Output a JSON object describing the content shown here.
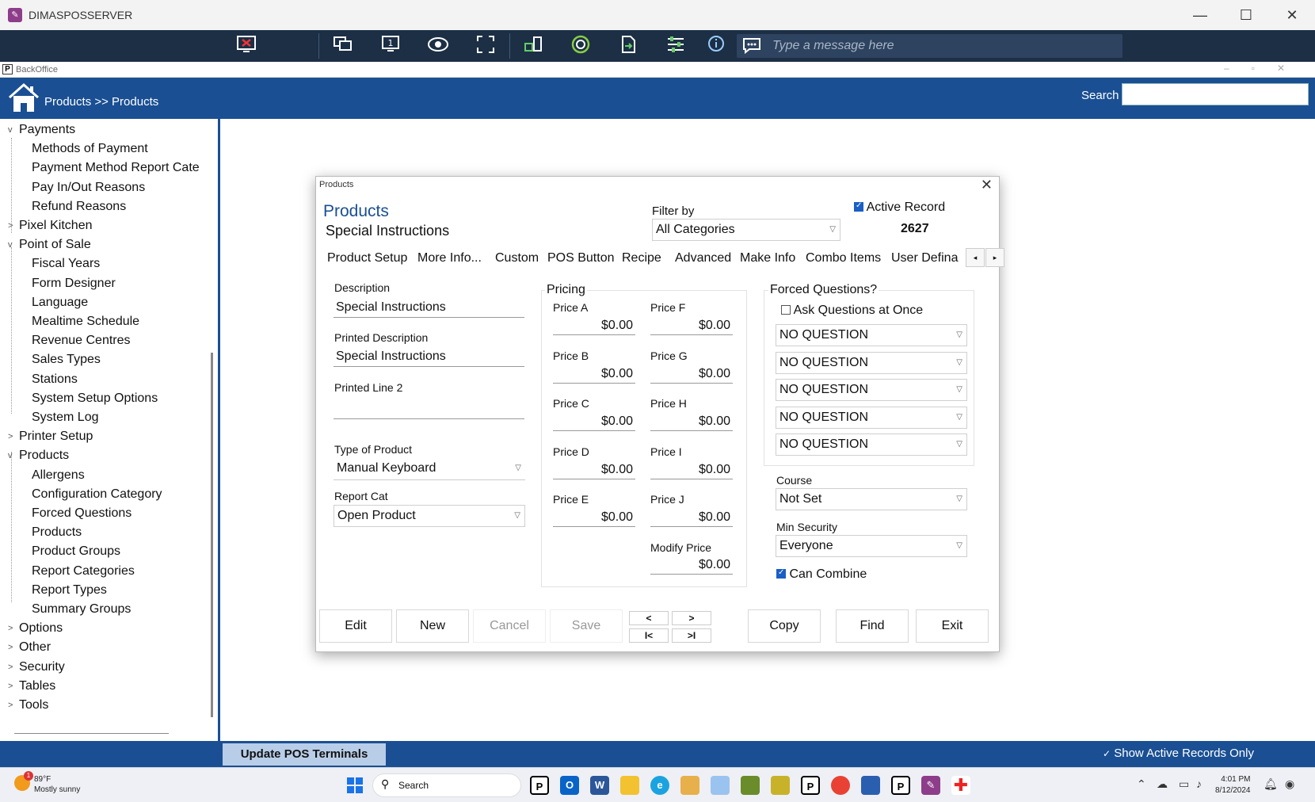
{
  "window": {
    "title": "DIMASPOSSERVER"
  },
  "remote_toolbar": {
    "message_placeholder": "Type a message here",
    "icons": [
      "disconnect-icon",
      "monitor-switch-icon",
      "monitor-1-icon",
      "eye-icon",
      "fullscreen-icon",
      "apps-icon",
      "record-icon",
      "file-transfer-icon",
      "settings-sliders-icon",
      "info-icon",
      "chat-icon"
    ]
  },
  "backoffice": {
    "title": "BackOffice"
  },
  "header": {
    "breadcrumb": "Products >> Products",
    "search_label": "Search",
    "search_value": ""
  },
  "sidebar": {
    "items": [
      {
        "label": "Payments",
        "toggle": "v"
      },
      {
        "label": "Methods of Payment"
      },
      {
        "label": "Payment Method Report Cate"
      },
      {
        "label": "Pay In/Out Reasons"
      },
      {
        "label": "Refund Reasons"
      },
      {
        "label": "Pixel Kitchen",
        "toggle": ">"
      },
      {
        "label": "Point of Sale",
        "toggle": "v"
      },
      {
        "label": "Fiscal Years"
      },
      {
        "label": "Form Designer"
      },
      {
        "label": "Language"
      },
      {
        "label": "Mealtime Schedule"
      },
      {
        "label": "Revenue Centres"
      },
      {
        "label": "Sales Types"
      },
      {
        "label": "Stations"
      },
      {
        "label": "System Setup Options"
      },
      {
        "label": "System Log"
      },
      {
        "label": "Printer Setup",
        "toggle": ">"
      },
      {
        "label": "Products",
        "toggle": "v"
      },
      {
        "label": "Allergens"
      },
      {
        "label": "Configuration Category"
      },
      {
        "label": "Forced Questions"
      },
      {
        "label": "Products"
      },
      {
        "label": "Product Groups"
      },
      {
        "label": "Report Categories"
      },
      {
        "label": "Report Types"
      },
      {
        "label": "Summary Groups"
      },
      {
        "label": "Options",
        "toggle": ">"
      },
      {
        "label": "Other",
        "toggle": ">"
      },
      {
        "label": "Security",
        "toggle": ">"
      },
      {
        "label": "Tables",
        "toggle": ">"
      },
      {
        "label": "Tools",
        "toggle": ">"
      }
    ]
  },
  "dialog": {
    "window_title": "Products",
    "close": "✕",
    "title": "Products",
    "subtitle": "Special Instructions",
    "filter_label": "Filter by",
    "filter_value": "All Categories",
    "active_record_label": "Active Record",
    "record_number": "2627",
    "tabs": [
      "Product Setup",
      "More Info...",
      "Custom",
      "POS Button",
      "Recipe",
      "Advanced",
      "Make Info",
      "Combo Items",
      "User Defina"
    ],
    "tab_prev": "◂",
    "tab_next": "▸",
    "description_label": "Description",
    "description_value": "Special Instructions",
    "printed_description_label": "Printed Description",
    "printed_description_value": "Special Instructions",
    "printed_line2_label": "Printed Line 2",
    "printed_line2_value": "",
    "type_label": "Type of Product",
    "type_value": "Manual Keyboard",
    "report_cat_label": "Report Cat",
    "report_cat_value": "Open Product",
    "pricing_label": "Pricing",
    "prices": [
      {
        "label": "Price A",
        "value": "$0.00"
      },
      {
        "label": "Price B",
        "value": "$0.00"
      },
      {
        "label": "Price C",
        "value": "$0.00"
      },
      {
        "label": "Price D",
        "value": "$0.00"
      },
      {
        "label": "Price E",
        "value": "$0.00"
      },
      {
        "label": "Price F",
        "value": "$0.00"
      },
      {
        "label": "Price G",
        "value": "$0.00"
      },
      {
        "label": "Price H",
        "value": "$0.00"
      },
      {
        "label": "Price I",
        "value": "$0.00"
      },
      {
        "label": "Price J",
        "value": "$0.00"
      }
    ],
    "modify_price_label": "Modify Price",
    "modify_price_value": "$0.00",
    "forced_questions_label": "Forced Questions?",
    "ask_at_once_label": "Ask Questions at Once",
    "questions": [
      "NO QUESTION",
      "NO QUESTION",
      "NO QUESTION",
      "NO QUESTION",
      "NO QUESTION"
    ],
    "course_label": "Course",
    "course_value": "Not Set",
    "min_security_label": "Min Security",
    "min_security_value": "Everyone",
    "can_combine_label": "Can Combine",
    "buttons": {
      "edit": "Edit",
      "new": "New",
      "cancel": "Cancel",
      "save": "Save",
      "prev": "<",
      "next": ">",
      "first": "I<",
      "last": ">I",
      "copy": "Copy",
      "find": "Find",
      "exit": "Exit"
    }
  },
  "bottombar": {
    "update_label": "Update POS Terminals",
    "show_active_label": "Show Active Records Only"
  },
  "taskbar": {
    "weather_temp": "89°F",
    "weather_desc": "Mostly sunny",
    "weather_badge": "1",
    "search_label": "Search",
    "time": "4:01 PM",
    "date": "8/12/2024"
  },
  "colors": {
    "brand_blue": "#1a4f93",
    "toolbar_dark": "#1c2f45",
    "check_blue": "#1a5fc4"
  }
}
